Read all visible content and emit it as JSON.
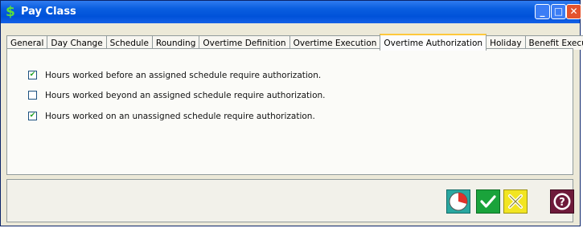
{
  "window": {
    "title": "Pay Class",
    "app_icon": "dollar-icon",
    "controls": [
      {
        "name": "minimize",
        "glyph": "_"
      },
      {
        "name": "maximize",
        "glyph": "□"
      },
      {
        "name": "close",
        "glyph": "✕"
      }
    ]
  },
  "tabs": [
    {
      "label": "General",
      "active": false
    },
    {
      "label": "Day Change",
      "active": false
    },
    {
      "label": "Schedule",
      "active": false
    },
    {
      "label": "Rounding",
      "active": false
    },
    {
      "label": "Overtime Definition",
      "active": false
    },
    {
      "label": "Overtime Execution",
      "active": false
    },
    {
      "label": "Overtime Authorization",
      "active": true
    },
    {
      "label": "Holiday",
      "active": false
    },
    {
      "label": "Benefit Execution",
      "active": false
    }
  ],
  "options": [
    {
      "label": "Hours worked before an assigned schedule require authorization.",
      "checked": true
    },
    {
      "label": "Hours worked beyond an assigned schedule require authorization.",
      "checked": false
    },
    {
      "label": "Hours worked on an unassigned schedule require authorization.",
      "checked": true
    }
  ],
  "footer_buttons": [
    {
      "name": "history",
      "icon": "clock-icon"
    },
    {
      "name": "ok",
      "icon": "checkmark-icon"
    },
    {
      "name": "cancel",
      "icon": "x-icon"
    },
    {
      "name": "help",
      "icon": "question-icon"
    }
  ],
  "colors": {
    "titlebar": "#0052d9",
    "dialog_bg": "#ece9d8",
    "check_green": "#21a121",
    "ok_button": "#1aa33b",
    "cancel_button": "#f2e522",
    "help_button": "#6e1a3a",
    "active_tab_accent": "#ffc83c"
  }
}
